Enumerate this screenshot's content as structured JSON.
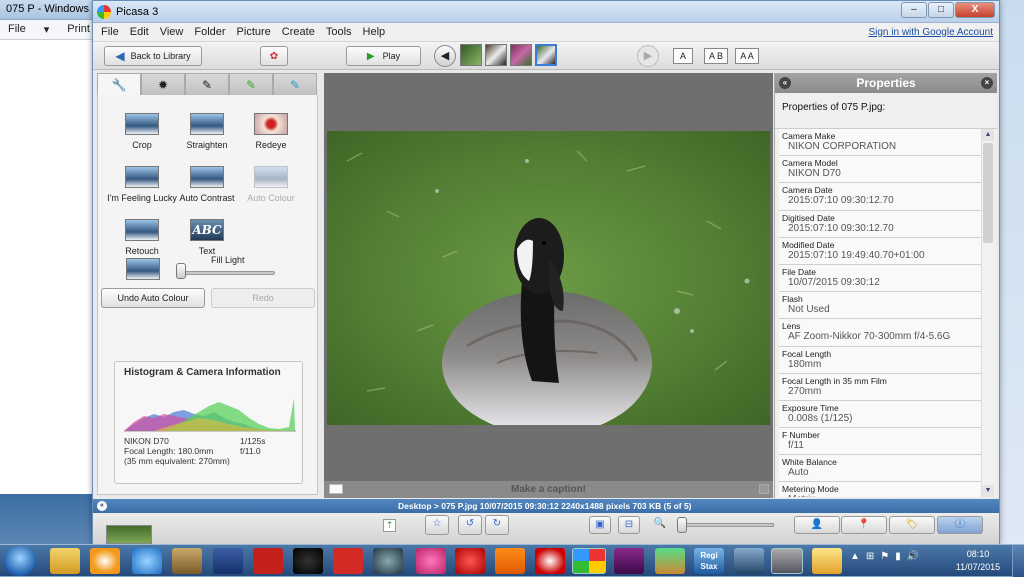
{
  "bg_window": {
    "title": "075 P - Windows",
    "menu": [
      "File",
      "▾",
      "Print"
    ]
  },
  "picasa": {
    "title": "Picasa 3",
    "window_controls": [
      "–",
      "□",
      "X"
    ],
    "menu": [
      "File",
      "Edit",
      "View",
      "Folder",
      "Picture",
      "Create",
      "Tools",
      "Help"
    ],
    "sign_in": "Sign in with Google Account",
    "toolbar": {
      "back": "Back to Library",
      "play": "Play",
      "caption_buttons": [
        "A",
        "A B",
        "A A"
      ]
    },
    "edit_tabs": [
      "wrench-icon",
      "sun-icon",
      "brush-icon",
      "green-brush-icon",
      "blue-brush-icon"
    ],
    "tools": [
      {
        "name": "crop",
        "label": "Crop",
        "enabled": true
      },
      {
        "name": "straighten",
        "label": "Straighten",
        "enabled": true
      },
      {
        "name": "redeye",
        "label": "Redeye",
        "enabled": true
      },
      {
        "name": "feeling-lucky",
        "label": "I'm Feeling Lucky",
        "enabled": true
      },
      {
        "name": "auto-contrast",
        "label": "Auto Contrast",
        "enabled": true
      },
      {
        "name": "auto-colour",
        "label": "Auto Colour",
        "enabled": false
      },
      {
        "name": "retouch",
        "label": "Retouch",
        "enabled": true
      },
      {
        "name": "text",
        "label": "Text",
        "enabled": true
      }
    ],
    "fill_light": {
      "label": "Fill Light",
      "value": 0
    },
    "undo": "Undo Auto Colour",
    "redo": "Redo",
    "histogram": {
      "title": "Histogram & Camera Information",
      "camera": "NIKON D70",
      "shutter": "1/125s",
      "focal": "Focal Length: 180.0mm",
      "aperture": "f/11.0",
      "equivalent": "(35 mm equivalent: 270mm)"
    },
    "caption_placeholder": "Make a caption!",
    "properties": {
      "title": "Properties",
      "of": "Properties of 075 P.jpg:",
      "items": [
        {
          "key": "Camera Make",
          "value": "NIKON CORPORATION"
        },
        {
          "key": "Camera Model",
          "value": "NIKON D70"
        },
        {
          "key": "Camera Date",
          "value": "2015:07:10 09:30:12.70"
        },
        {
          "key": "Digitised Date",
          "value": "2015:07:10 09:30:12.70"
        },
        {
          "key": "Modified Date",
          "value": "2015:07:10 19:49:40.70+01:00"
        },
        {
          "key": "File Date",
          "value": "10/07/2015 09:30:12"
        },
        {
          "key": "Flash",
          "value": "Not Used"
        },
        {
          "key": "Lens",
          "value": "AF Zoom-Nikkor 70-300mm f/4-5.6G"
        },
        {
          "key": "Focal Length",
          "value": "180mm"
        },
        {
          "key": "Focal Length in 35 mm Film",
          "value": "270mm"
        },
        {
          "key": "Exposure Time",
          "value": "0.008s (1/125)"
        },
        {
          "key": "F Number",
          "value": "f/11"
        },
        {
          "key": "White Balance",
          "value": "Auto"
        },
        {
          "key": "Metering Mode",
          "value": "Matrix"
        }
      ]
    },
    "status": "Desktop > 075 P.jpg   10/07/2015 09:30:12   2240x1488 pixels   703 KB   (5 of 5)"
  },
  "taskbar": {
    "clock_time": "08:10",
    "clock_date": "11/07/2015",
    "app_labels": [
      "Regi Stax"
    ]
  }
}
